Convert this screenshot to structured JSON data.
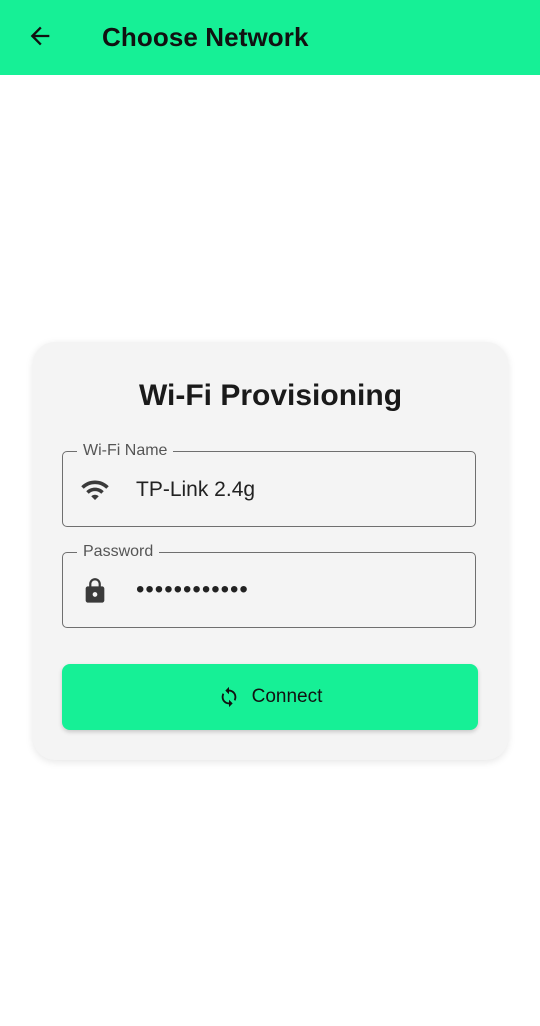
{
  "app_bar": {
    "title": "Choose Network",
    "back_icon": "arrow-left-icon",
    "color": "#16f096"
  },
  "card": {
    "title": "Wi-Fi Provisioning",
    "wifi_field": {
      "label": "Wi-Fi Name",
      "value": "TP-Link 2.4g",
      "icon": "wifi-icon"
    },
    "password_field": {
      "label": "Password",
      "value": "••••••••••••",
      "icon": "lock-icon"
    },
    "connect_button": {
      "label": "Connect",
      "icon": "sync-icon"
    }
  }
}
